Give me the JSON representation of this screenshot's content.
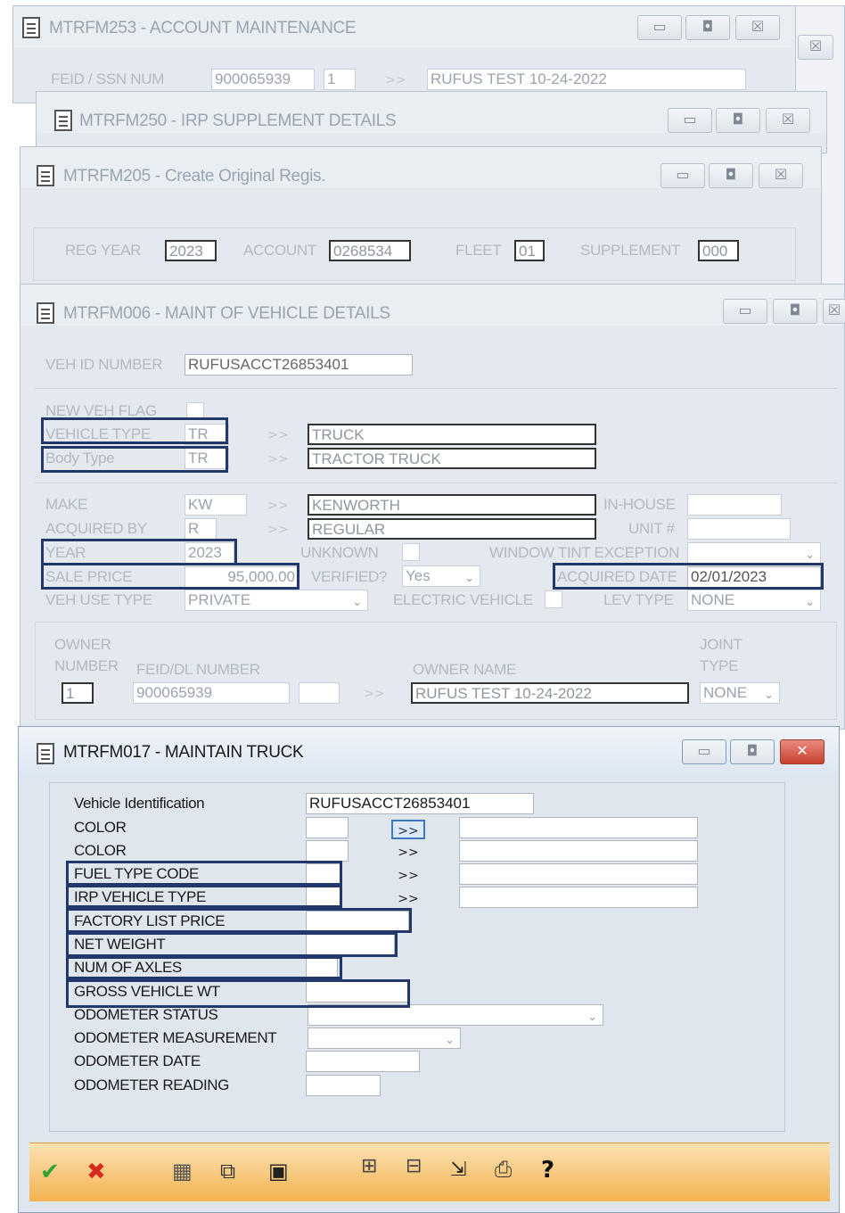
{
  "win253": {
    "title": "MTRFM253 - ACCOUNT MAINTENANCE",
    "fein_label": "FEID / SSN NUM",
    "fein": "900065939",
    "seq": "1",
    "go": ">>",
    "name": "RUFUS TEST 10-24-2022"
  },
  "win250": {
    "title": "MTRFM250 - IRP SUPPLEMENT DETAILS"
  },
  "win205": {
    "title": "MTRFM205 - Create Original Regis.",
    "reg_year_label": "REG YEAR",
    "reg_year": "2023",
    "account_label": "ACCOUNT",
    "account": "0268534",
    "fleet_label": "FLEET",
    "fleet": "01",
    "supplement_label": "SUPPLEMENT",
    "supplement": "000"
  },
  "win006": {
    "title": "MTRFM006 - MAINT OF VEHICLE DETAILS",
    "veh_id_label": "VEH ID NUMBER",
    "veh_id": "RUFUSACCT26853401",
    "new_veh_flag_label": "NEW VEH FLAG",
    "vehicle_type_label": "VEHICLE TYPE",
    "vehicle_type": "TR",
    "vehicle_type_desc": "TRUCK",
    "body_type_label": "Body Type",
    "body_type": "TR",
    "body_type_desc": "TRACTOR TRUCK",
    "make_label": "MAKE",
    "make": "KW",
    "make_desc": "KENWORTH",
    "in_house_label": "IN-HOUSE",
    "acquired_by_label": "ACQUIRED BY",
    "acquired_by": "R",
    "acquired_by_desc": "REGULAR",
    "unit_label": "UNIT #",
    "year_label": "YEAR",
    "year": "2023",
    "unknown_label": "UNKNOWN",
    "window_tint_label": "WINDOW TINT EXCEPTION",
    "sale_price_label": "SALE PRICE",
    "sale_price": "95,000.00",
    "verified_label": "VERIFIED?",
    "verified": "Yes",
    "acquired_date_label": "ACQUIRED DATE",
    "acquired_date": "02/01/2023",
    "veh_use_label": "VEH USE TYPE",
    "veh_use": "PRIVATE",
    "electric_label": "ELECTRIC VEHICLE",
    "lev_label": "LEV TYPE",
    "lev": "NONE",
    "owner_label_1": "OWNER",
    "owner_label_2": "NUMBER",
    "feid_dl_label": "FEID/DL NUMBER",
    "owner_name_label": "OWNER NAME",
    "joint_label_1": "JOINT",
    "joint_label_2": "TYPE",
    "owner_number": "1",
    "feid_dl": "900065939",
    "owner_name": "RUFUS TEST 10-24-2022",
    "joint": "NONE",
    "go": ">>"
  },
  "win017": {
    "title": "MTRFM017 - MAINTAIN TRUCK",
    "vin_label": "Vehicle Identification",
    "vin": "RUFUSACCT26853401",
    "color1_label": "COLOR",
    "color2_label": "COLOR",
    "fuel_label": "FUEL TYPE CODE",
    "irp_label": "IRP VEHICLE TYPE",
    "factory_label": "FACTORY LIST PRICE",
    "net_weight_label": "NET WEIGHT",
    "axles_label": "NUM OF AXLES",
    "gross_label": "GROSS VEHICLE WT",
    "odo_status_label": "ODOMETER STATUS",
    "odo_meas_label": "ODOMETER MEASUREMENT",
    "odo_date_label": "ODOMETER DATE",
    "odo_reading_label": "ODOMETER READING",
    "go": ">>"
  },
  "colors": {
    "highlight": "#22386a",
    "toolbar": "#f3b24f",
    "close": "#d9534f"
  }
}
